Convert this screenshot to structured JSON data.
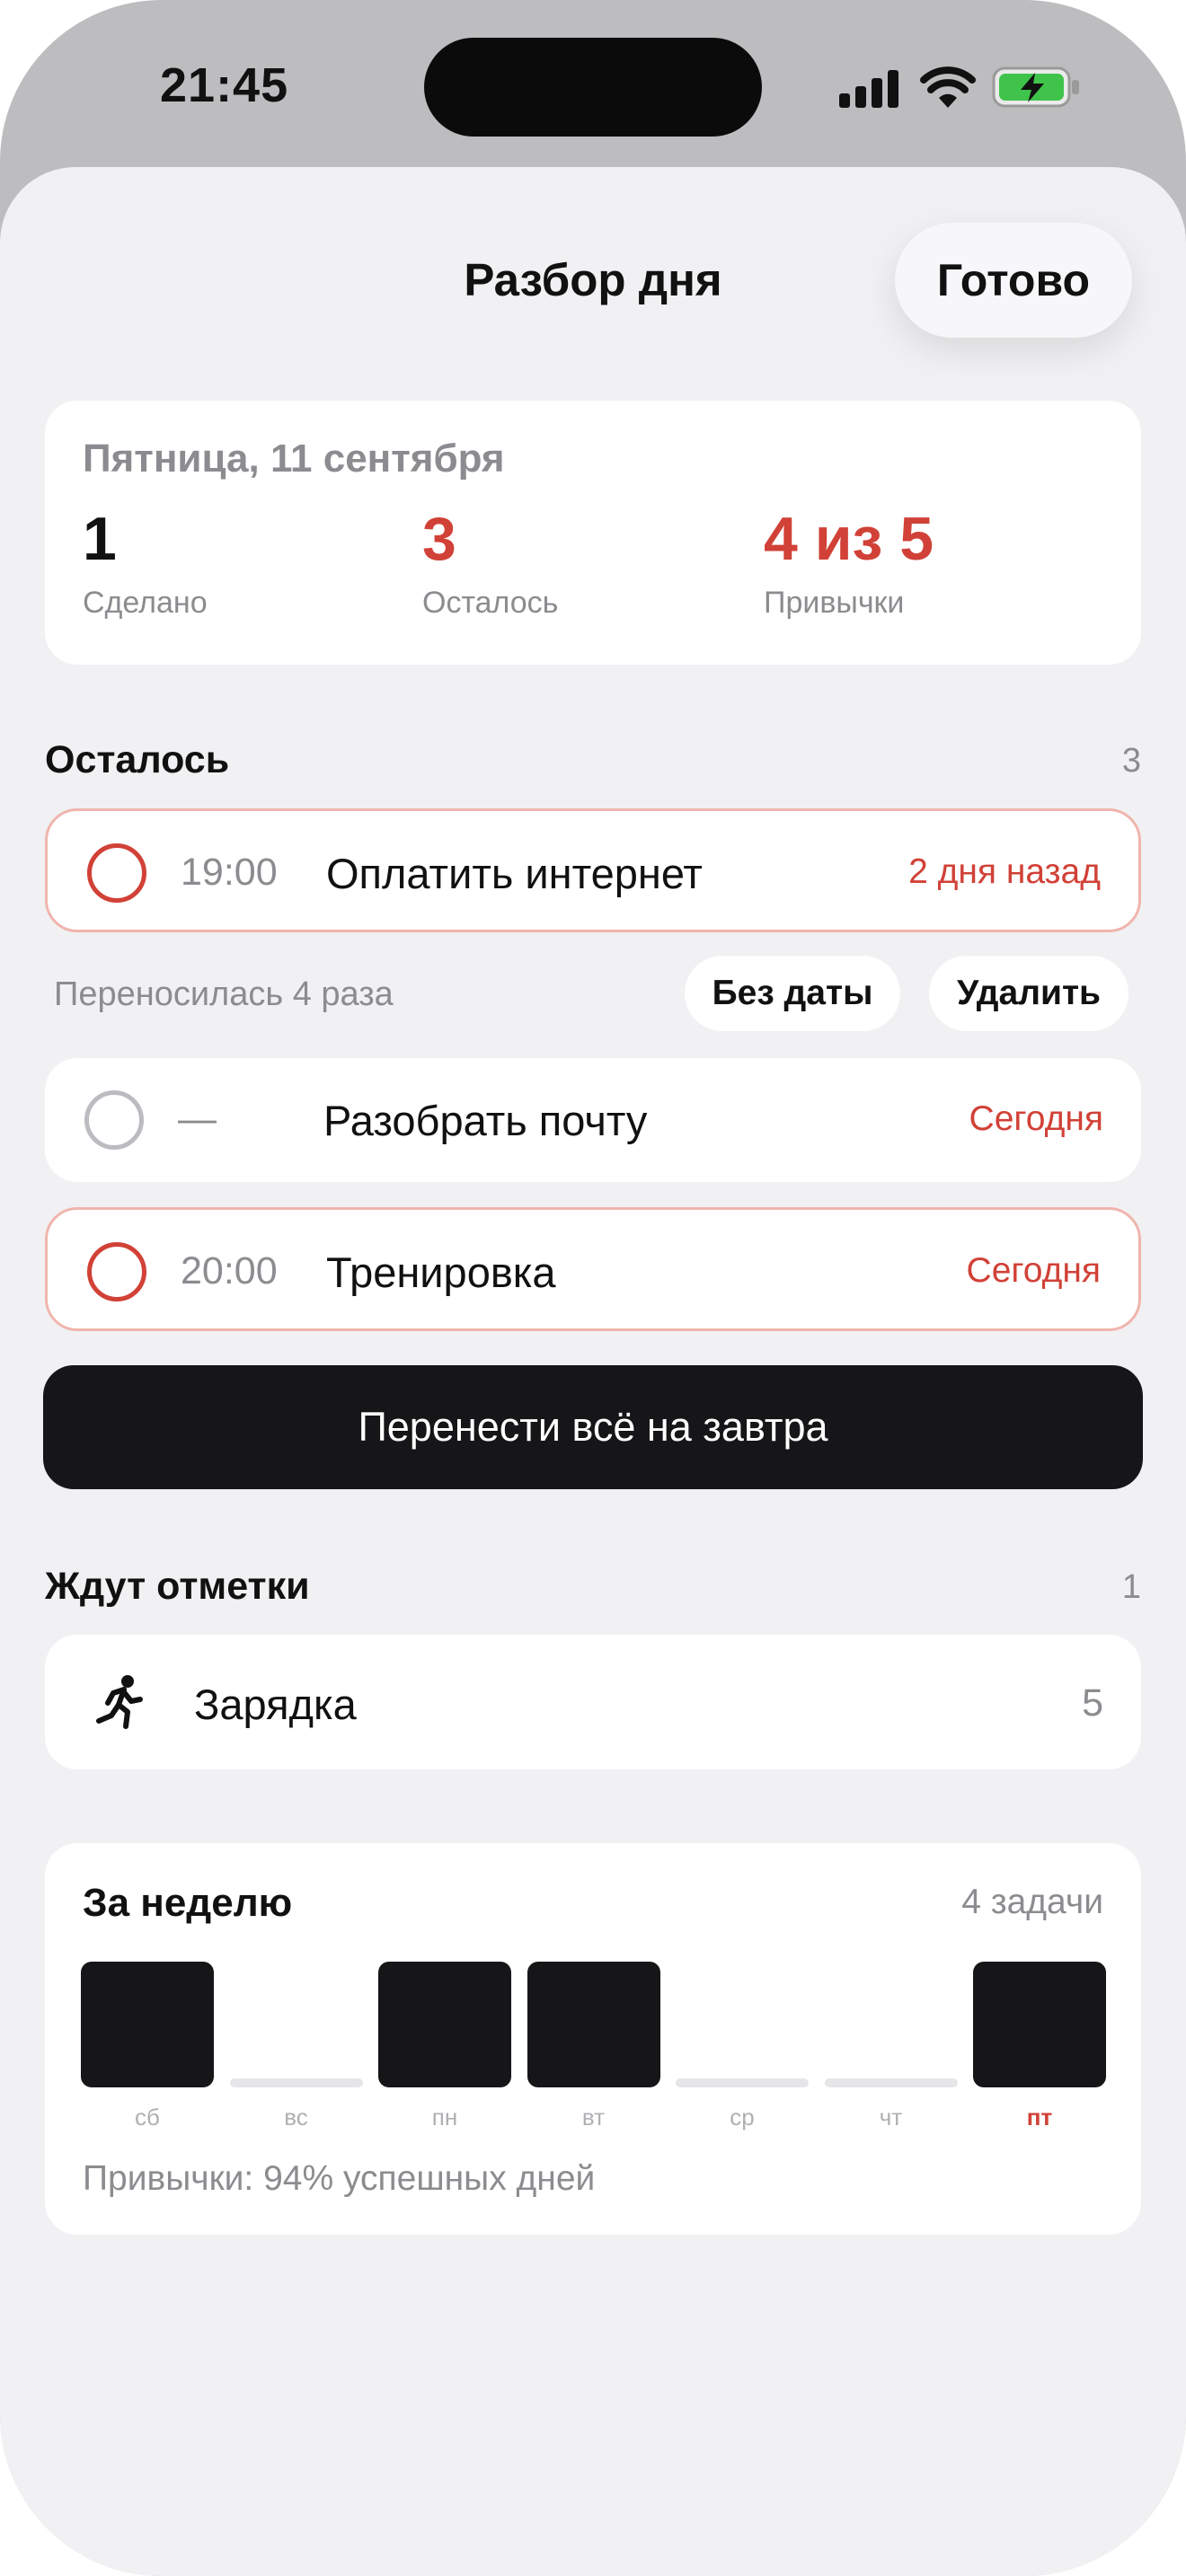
{
  "status_bar": {
    "time": "21:45"
  },
  "header": {
    "title": "Разбор дня",
    "done_label": "Готово"
  },
  "summary": {
    "date": "Пятница, 11 сентября",
    "stats": [
      {
        "value": "1",
        "label": "Сделано"
      },
      {
        "value": "3",
        "label": "Осталось"
      },
      {
        "value": "4 из 5",
        "label": "Привычки"
      }
    ]
  },
  "remaining": {
    "title": "Осталось",
    "count": "3",
    "tasks": [
      {
        "time": "19:00",
        "name": "Оплатить интернет",
        "due": "2 дня назад"
      },
      {
        "time": "—",
        "name": "Разобрать почту",
        "due": "Сегодня"
      },
      {
        "time": "20:00",
        "name": "Тренировка",
        "due": "Сегодня"
      }
    ],
    "postponed_note": "Переносилась 4 раза",
    "no_date_label": "Без даты",
    "delete_label": "Удалить",
    "move_all_label": "Перенести всё на завтра"
  },
  "awaiting": {
    "title": "Ждут отметки",
    "count": "1",
    "habits": [
      {
        "icon": "running-icon",
        "name": "Зарядка",
        "streak": "5"
      }
    ]
  },
  "week": {
    "title": "За неделю",
    "count": "4 задачи",
    "days": [
      "сб",
      "вс",
      "пн",
      "вт",
      "ср",
      "чт",
      "пт"
    ],
    "completed": [
      1,
      0,
      1,
      1,
      0,
      0,
      1
    ],
    "today_index": 6,
    "habits_note": "Привычки: 94% успешных дней"
  },
  "colors": {
    "accent_red": "#d14137",
    "dark": "#161618",
    "sheet_bg": "#f1f1f3"
  }
}
